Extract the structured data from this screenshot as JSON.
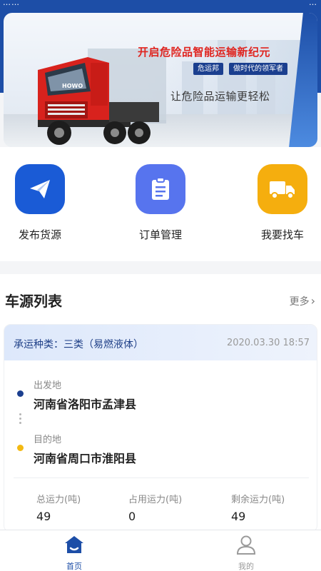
{
  "status_bar": {
    "left": "……",
    "right": "…"
  },
  "banner": {
    "headline": "开启危险品智能运输新纪元",
    "badges": [
      "危运邦",
      "做时代的领军者"
    ],
    "subline": "让危险品运输更轻松",
    "truck_brand": "HOWO"
  },
  "quick_actions": [
    {
      "label": "发布货源",
      "icon": "paper-plane-icon",
      "color": "#1a5bd6"
    },
    {
      "label": "订单管理",
      "icon": "clipboard-icon",
      "color": "#5774ee"
    },
    {
      "label": "我要找车",
      "icon": "truck-icon",
      "color": "#f5ae0e"
    }
  ],
  "list": {
    "title": "车源列表",
    "more": "更多",
    "card": {
      "cargo_type": "承运种类：三类（易燃液体）",
      "time": "2020.03.30 18:57",
      "from_label": "出发地",
      "from_value": "河南省洛阳市孟津县",
      "to_label": "目的地",
      "to_value": "河南省周口市淮阳县",
      "stats": [
        {
          "label": "总运力(吨)",
          "value": "49"
        },
        {
          "label": "占用运力(吨)",
          "value": "0"
        },
        {
          "label": "剩余运力(吨)",
          "value": "49"
        }
      ]
    }
  },
  "tabbar": {
    "home": "首页",
    "mine": "我的",
    "active_color": "#1d4ea7"
  }
}
